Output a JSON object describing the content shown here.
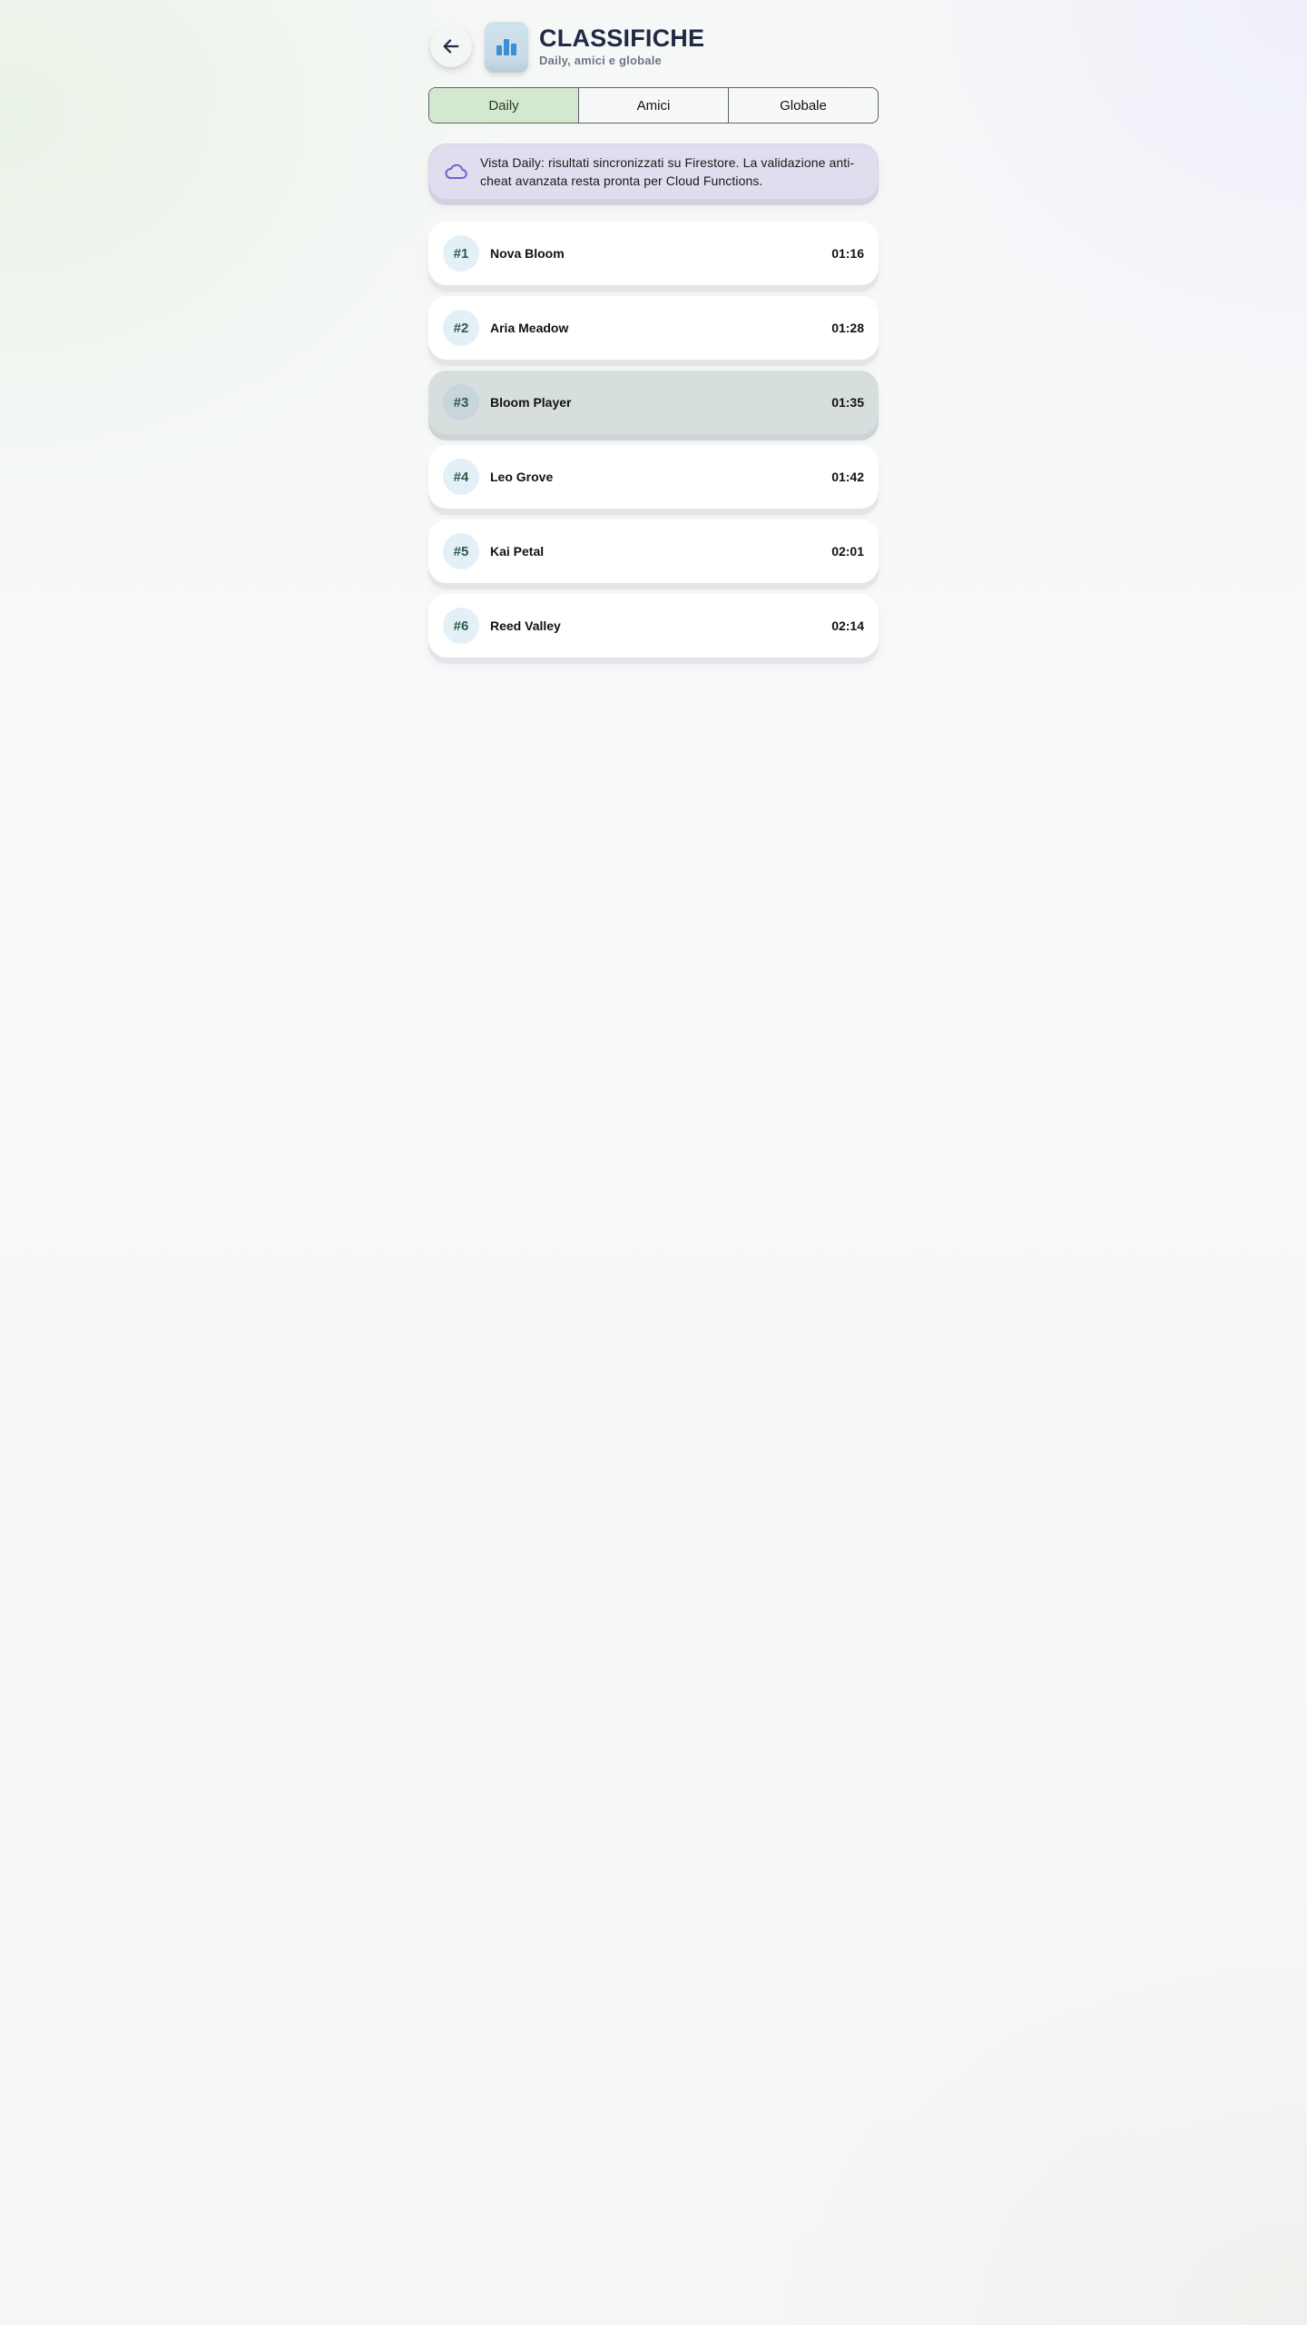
{
  "header": {
    "title": "CLASSIFICHE",
    "subtitle": "Daily, amici e globale",
    "back_icon": "arrow-left-icon",
    "app_icon": "bar-chart-icon"
  },
  "tabs": [
    {
      "label": "Daily",
      "active": true
    },
    {
      "label": "Amici",
      "active": false
    },
    {
      "label": "Globale",
      "active": false
    }
  ],
  "info": {
    "icon": "cloud-icon",
    "text": "Vista Daily: risultati sincronizzati su Firestore. La validazione anti-cheat avanzata resta pronta per Cloud Functions."
  },
  "leaderboard": [
    {
      "rank": "#1",
      "name": "Nova Bloom",
      "time": "01:16",
      "highlight": false
    },
    {
      "rank": "#2",
      "name": "Aria Meadow",
      "time": "01:28",
      "highlight": false
    },
    {
      "rank": "#3",
      "name": "Bloom Player",
      "time": "01:35",
      "highlight": true
    },
    {
      "rank": "#4",
      "name": "Leo Grove",
      "time": "01:42",
      "highlight": false
    },
    {
      "rank": "#5",
      "name": "Kai Petal",
      "time": "02:01",
      "highlight": false
    },
    {
      "rank": "#6",
      "name": "Reed Valley",
      "time": "02:14",
      "highlight": false
    }
  ],
  "colors": {
    "active_tab": "#d4e8d0",
    "info_banner": "#e0ddee",
    "highlight_row": "#d6dfdd",
    "rank_badge": "#e4f0f8",
    "title": "#1f2a44",
    "accent_icon": "#3a8fd6",
    "cloud_icon": "#7b5cd6"
  }
}
